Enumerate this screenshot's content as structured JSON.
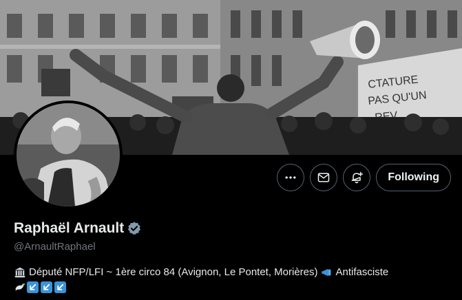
{
  "profile": {
    "display_name": "Raphaël Arnault",
    "handle": "@ArnaultRaphael",
    "verified": true,
    "bio_text": "Député NFP/LFI ~ 1ère circo 84 (Avignon, Le Pontet, Morières)",
    "bio_suffix": "Antifasciste",
    "bio_icons": [
      "classical-building-icon",
      "megaphone-icon",
      "dove-icon",
      "arrow-down-left-icon",
      "arrow-down-left-icon",
      "arrow-down-left-icon"
    ]
  },
  "actions": {
    "more_label": "More",
    "message_label": "Message",
    "notify_label": "Turn on notifications",
    "follow_label": "Following"
  },
  "colors": {
    "background": "#000000",
    "verified_badge": "#829aab",
    "arrow_emoji": "#3b94d9",
    "secondary_text": "#71767b",
    "button_border": "#536471"
  }
}
